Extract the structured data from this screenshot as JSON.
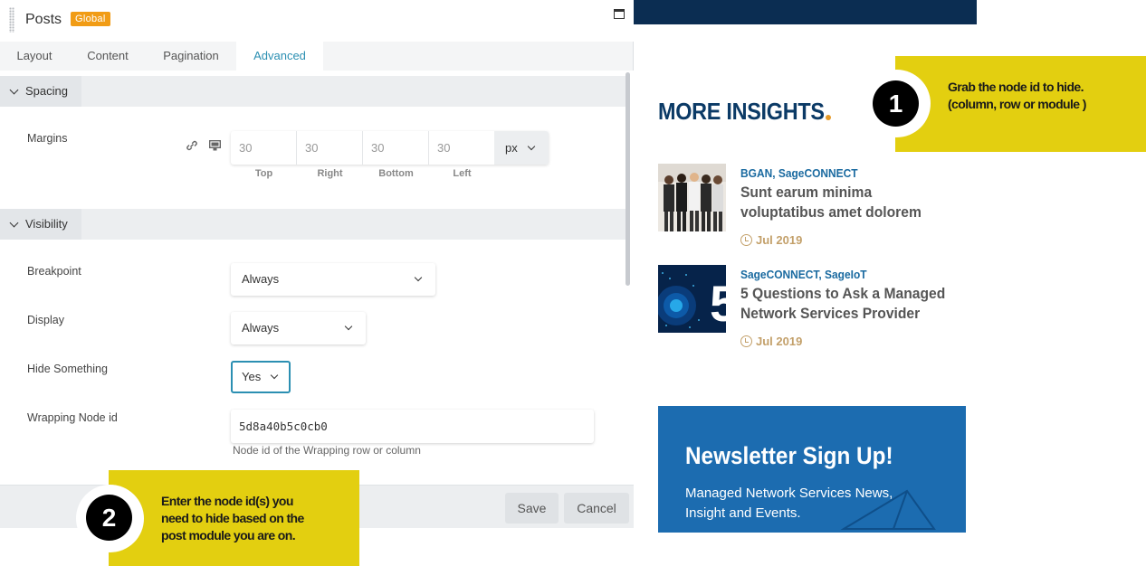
{
  "panel": {
    "title": "Posts",
    "badge": "Global",
    "tabs": [
      "Layout",
      "Content",
      "Pagination",
      "Advanced"
    ],
    "active_tab": "Advanced",
    "sections": {
      "spacing": {
        "title": "Spacing",
        "margins_label": "Margins",
        "margins": {
          "top": "30",
          "right": "30",
          "bottom": "30",
          "left": "30",
          "sublabels": [
            "Top",
            "Right",
            "Bottom",
            "Left"
          ],
          "unit": "px"
        }
      },
      "visibility": {
        "title": "Visibility",
        "breakpoint_label": "Breakpoint",
        "breakpoint_value": "Always",
        "display_label": "Display",
        "display_value": "Always",
        "hide_label": "Hide Something",
        "hide_value": "Yes",
        "node_label": "Wrapping Node id",
        "node_value": "5d8a40b5c0cb0",
        "node_help": "Node id of the Wrapping row or column"
      }
    },
    "footer": {
      "save": "Save",
      "cancel": "Cancel"
    }
  },
  "site": {
    "heading": "MORE INSIGHTS",
    "accent_color": "#e69a28",
    "posts": [
      {
        "categories": "BGAN, SageCONNECT",
        "title": "Sunt earum minima voluptatibus amet dolorem",
        "date": "Jul 2019"
      },
      {
        "categories": "SageCONNECT, SageIoT",
        "title": "5 Questions to Ask a Managed Network Services Provider",
        "date": "Jul 2019"
      }
    ],
    "newsletter": {
      "title": "Newsletter Sign Up!",
      "subtitle": "Managed Network Services News, Insight and Events."
    }
  },
  "callouts": [
    {
      "number": "1",
      "text": "Grab the node id to hide.\n(column, row or module )"
    },
    {
      "number": "2",
      "text": "Enter the node id(s)  you\nneed to hide based on the\npost module you are on."
    }
  ],
  "colors": {
    "brand_navy": "#0b2d52",
    "heading_blue": "#0b3a66",
    "link_blue": "#1a6aa0",
    "newsletter_blue": "#1c6cb0",
    "callout_yellow": "#e3cf10",
    "active_tab": "#2b8fb2",
    "badge_orange": "#f19c15"
  }
}
